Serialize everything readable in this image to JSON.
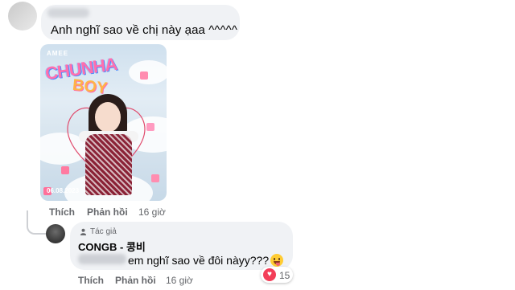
{
  "top_comment": {
    "text": "Anh nghĩ sao về chị này ạaa ^^^^^",
    "actions": {
      "like": "Thích",
      "reply": "Phản hồi",
      "time": "16 giờ"
    },
    "image": {
      "brand": "AMEE",
      "title_line1": "CHUNHA",
      "title_line2": "BOY",
      "date": "06.08.2023"
    }
  },
  "reply_comment": {
    "author_badge": "Tác giả",
    "name": "CONGB - 콩비",
    "text": "em nghĩ sao về đôi nàyy???",
    "emoji": "tongue-out-emoji",
    "actions": {
      "like": "Thích",
      "reply": "Phản hồi",
      "time": "16 giờ"
    },
    "reactions": {
      "type": "heart",
      "count": "15",
      "color": "#f33e58"
    }
  },
  "colors": {
    "bubble": "#f0f2f5",
    "meta_text": "#65676b",
    "text": "#050505"
  }
}
